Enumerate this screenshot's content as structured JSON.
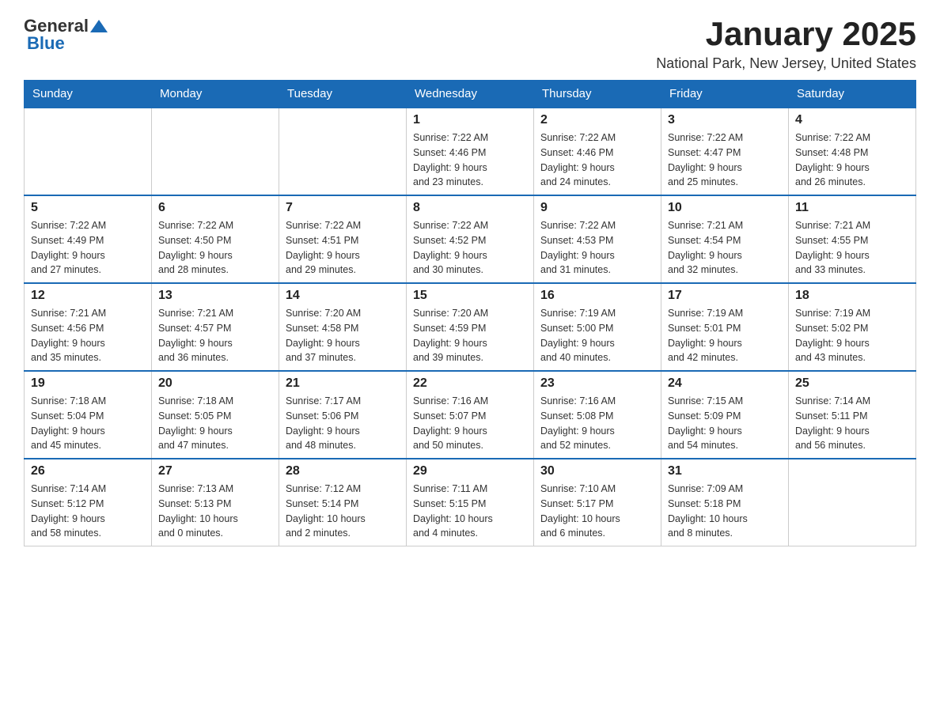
{
  "header": {
    "logo_general": "General",
    "logo_blue": "Blue",
    "month_title": "January 2025",
    "location": "National Park, New Jersey, United States"
  },
  "weekdays": [
    "Sunday",
    "Monday",
    "Tuesday",
    "Wednesday",
    "Thursday",
    "Friday",
    "Saturday"
  ],
  "weeks": [
    [
      {
        "day": "",
        "info": ""
      },
      {
        "day": "",
        "info": ""
      },
      {
        "day": "",
        "info": ""
      },
      {
        "day": "1",
        "info": "Sunrise: 7:22 AM\nSunset: 4:46 PM\nDaylight: 9 hours\nand 23 minutes."
      },
      {
        "day": "2",
        "info": "Sunrise: 7:22 AM\nSunset: 4:46 PM\nDaylight: 9 hours\nand 24 minutes."
      },
      {
        "day": "3",
        "info": "Sunrise: 7:22 AM\nSunset: 4:47 PM\nDaylight: 9 hours\nand 25 minutes."
      },
      {
        "day": "4",
        "info": "Sunrise: 7:22 AM\nSunset: 4:48 PM\nDaylight: 9 hours\nand 26 minutes."
      }
    ],
    [
      {
        "day": "5",
        "info": "Sunrise: 7:22 AM\nSunset: 4:49 PM\nDaylight: 9 hours\nand 27 minutes."
      },
      {
        "day": "6",
        "info": "Sunrise: 7:22 AM\nSunset: 4:50 PM\nDaylight: 9 hours\nand 28 minutes."
      },
      {
        "day": "7",
        "info": "Sunrise: 7:22 AM\nSunset: 4:51 PM\nDaylight: 9 hours\nand 29 minutes."
      },
      {
        "day": "8",
        "info": "Sunrise: 7:22 AM\nSunset: 4:52 PM\nDaylight: 9 hours\nand 30 minutes."
      },
      {
        "day": "9",
        "info": "Sunrise: 7:22 AM\nSunset: 4:53 PM\nDaylight: 9 hours\nand 31 minutes."
      },
      {
        "day": "10",
        "info": "Sunrise: 7:21 AM\nSunset: 4:54 PM\nDaylight: 9 hours\nand 32 minutes."
      },
      {
        "day": "11",
        "info": "Sunrise: 7:21 AM\nSunset: 4:55 PM\nDaylight: 9 hours\nand 33 minutes."
      }
    ],
    [
      {
        "day": "12",
        "info": "Sunrise: 7:21 AM\nSunset: 4:56 PM\nDaylight: 9 hours\nand 35 minutes."
      },
      {
        "day": "13",
        "info": "Sunrise: 7:21 AM\nSunset: 4:57 PM\nDaylight: 9 hours\nand 36 minutes."
      },
      {
        "day": "14",
        "info": "Sunrise: 7:20 AM\nSunset: 4:58 PM\nDaylight: 9 hours\nand 37 minutes."
      },
      {
        "day": "15",
        "info": "Sunrise: 7:20 AM\nSunset: 4:59 PM\nDaylight: 9 hours\nand 39 minutes."
      },
      {
        "day": "16",
        "info": "Sunrise: 7:19 AM\nSunset: 5:00 PM\nDaylight: 9 hours\nand 40 minutes."
      },
      {
        "day": "17",
        "info": "Sunrise: 7:19 AM\nSunset: 5:01 PM\nDaylight: 9 hours\nand 42 minutes."
      },
      {
        "day": "18",
        "info": "Sunrise: 7:19 AM\nSunset: 5:02 PM\nDaylight: 9 hours\nand 43 minutes."
      }
    ],
    [
      {
        "day": "19",
        "info": "Sunrise: 7:18 AM\nSunset: 5:04 PM\nDaylight: 9 hours\nand 45 minutes."
      },
      {
        "day": "20",
        "info": "Sunrise: 7:18 AM\nSunset: 5:05 PM\nDaylight: 9 hours\nand 47 minutes."
      },
      {
        "day": "21",
        "info": "Sunrise: 7:17 AM\nSunset: 5:06 PM\nDaylight: 9 hours\nand 48 minutes."
      },
      {
        "day": "22",
        "info": "Sunrise: 7:16 AM\nSunset: 5:07 PM\nDaylight: 9 hours\nand 50 minutes."
      },
      {
        "day": "23",
        "info": "Sunrise: 7:16 AM\nSunset: 5:08 PM\nDaylight: 9 hours\nand 52 minutes."
      },
      {
        "day": "24",
        "info": "Sunrise: 7:15 AM\nSunset: 5:09 PM\nDaylight: 9 hours\nand 54 minutes."
      },
      {
        "day": "25",
        "info": "Sunrise: 7:14 AM\nSunset: 5:11 PM\nDaylight: 9 hours\nand 56 minutes."
      }
    ],
    [
      {
        "day": "26",
        "info": "Sunrise: 7:14 AM\nSunset: 5:12 PM\nDaylight: 9 hours\nand 58 minutes."
      },
      {
        "day": "27",
        "info": "Sunrise: 7:13 AM\nSunset: 5:13 PM\nDaylight: 10 hours\nand 0 minutes."
      },
      {
        "day": "28",
        "info": "Sunrise: 7:12 AM\nSunset: 5:14 PM\nDaylight: 10 hours\nand 2 minutes."
      },
      {
        "day": "29",
        "info": "Sunrise: 7:11 AM\nSunset: 5:15 PM\nDaylight: 10 hours\nand 4 minutes."
      },
      {
        "day": "30",
        "info": "Sunrise: 7:10 AM\nSunset: 5:17 PM\nDaylight: 10 hours\nand 6 minutes."
      },
      {
        "day": "31",
        "info": "Sunrise: 7:09 AM\nSunset: 5:18 PM\nDaylight: 10 hours\nand 8 minutes."
      },
      {
        "day": "",
        "info": ""
      }
    ]
  ]
}
